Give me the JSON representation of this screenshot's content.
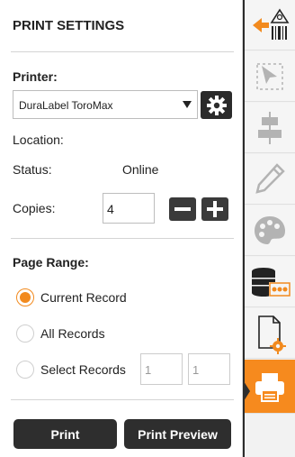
{
  "panel": {
    "title": "PRINT SETTINGS",
    "printer_label": "Printer:",
    "printer_value": "DuraLabel ToroMax",
    "location_label": "Location:",
    "status_label": "Status:",
    "status_value": "Online",
    "copies_label": "Copies:",
    "copies_value": "4",
    "page_range_label": "Page Range:",
    "range_options": [
      {
        "label": "Current Record",
        "selected": true
      },
      {
        "label": "All Records",
        "selected": false
      },
      {
        "label": "Select Records",
        "selected": false
      }
    ],
    "range_from_placeholder": "1",
    "range_to_placeholder": "1",
    "print_button": "Print",
    "preview_button": "Print Preview"
  },
  "sidebar": {
    "items": [
      {
        "icon": "barcode-import-icon",
        "active": false
      },
      {
        "icon": "select-cursor-icon",
        "active": false
      },
      {
        "icon": "align-center-icon",
        "active": false
      },
      {
        "icon": "pencil-icon",
        "active": false
      },
      {
        "icon": "palette-icon",
        "active": false
      },
      {
        "icon": "database-records-icon",
        "active": false
      },
      {
        "icon": "document-settings-icon",
        "active": false
      },
      {
        "icon": "printer-icon",
        "active": true
      }
    ]
  },
  "colors": {
    "accent": "#f68a1e",
    "dark_button": "#2e2e2e",
    "icon_gray": "#b3b3b3"
  }
}
